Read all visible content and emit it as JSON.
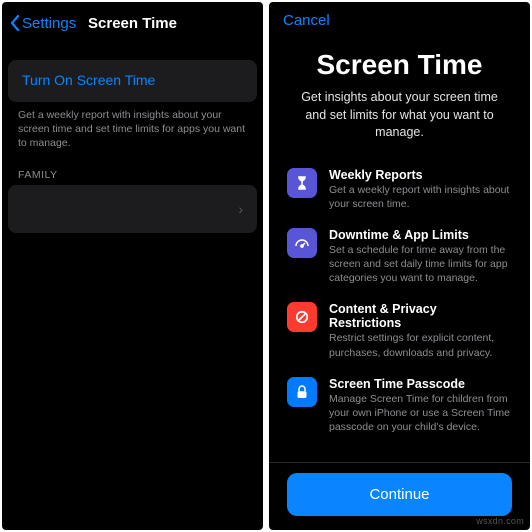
{
  "left": {
    "back_label": "Settings",
    "title": "Screen Time",
    "turn_on": "Turn On Screen Time",
    "footer": "Get a weekly report with insights about your screen time and set time limits for apps you want to manage.",
    "family_header": "FAMILY"
  },
  "right": {
    "cancel": "Cancel",
    "title": "Screen Time",
    "subtitle": "Get insights about your screen time and set limits for what you want to manage.",
    "features": [
      {
        "title": "Weekly Reports",
        "desc": "Get a weekly report with insights about your screen time.",
        "color": "#5856d6"
      },
      {
        "title": "Downtime & App Limits",
        "desc": "Set a schedule for time away from the screen and set daily time limits for app categories you want to manage.",
        "color": "#5856d6"
      },
      {
        "title": "Content & Privacy Restrictions",
        "desc": "Restrict settings for explicit content, purchases, downloads and privacy.",
        "color": "#ff3b30"
      },
      {
        "title": "Screen Time Passcode",
        "desc": "Manage Screen Time for children from your own iPhone or use a Screen Time passcode on your child's device.",
        "color": "#007aff"
      }
    ],
    "continue": "Continue"
  },
  "watermark": "wsxdn.com"
}
